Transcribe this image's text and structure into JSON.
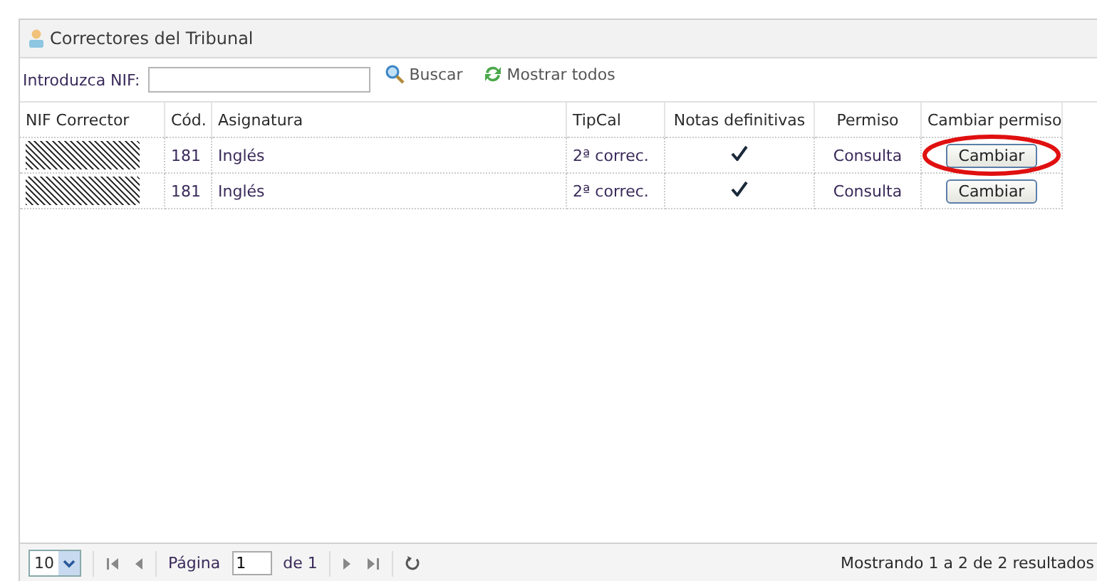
{
  "panel": {
    "title": "Correctores del Tribunal"
  },
  "toolbar": {
    "nif_label": "Introduzca NIF:",
    "search_button": "Buscar",
    "show_all_button": "Mostrar todos"
  },
  "table": {
    "columns": [
      "NIF Corrector",
      "Cód.",
      "Asignatura",
      "TipCal",
      "Notas definitivas",
      "Permiso",
      "Cambiar permiso"
    ],
    "rows": [
      {
        "code": "181",
        "subject": "Inglés",
        "tipcal": "2ª correc.",
        "final_grades": true,
        "permission": "Consulta",
        "action": "Cambiar",
        "highlighted": true
      },
      {
        "code": "181",
        "subject": "Inglés",
        "tipcal": "2ª correc.",
        "final_grades": true,
        "permission": "Consulta",
        "action": "Cambiar",
        "highlighted": false
      }
    ]
  },
  "pager": {
    "page_size": "10",
    "page_label": "Página",
    "page": "1",
    "of_label": "de 1",
    "summary": "Mostrando 1 a 2 de 2 resultados"
  }
}
